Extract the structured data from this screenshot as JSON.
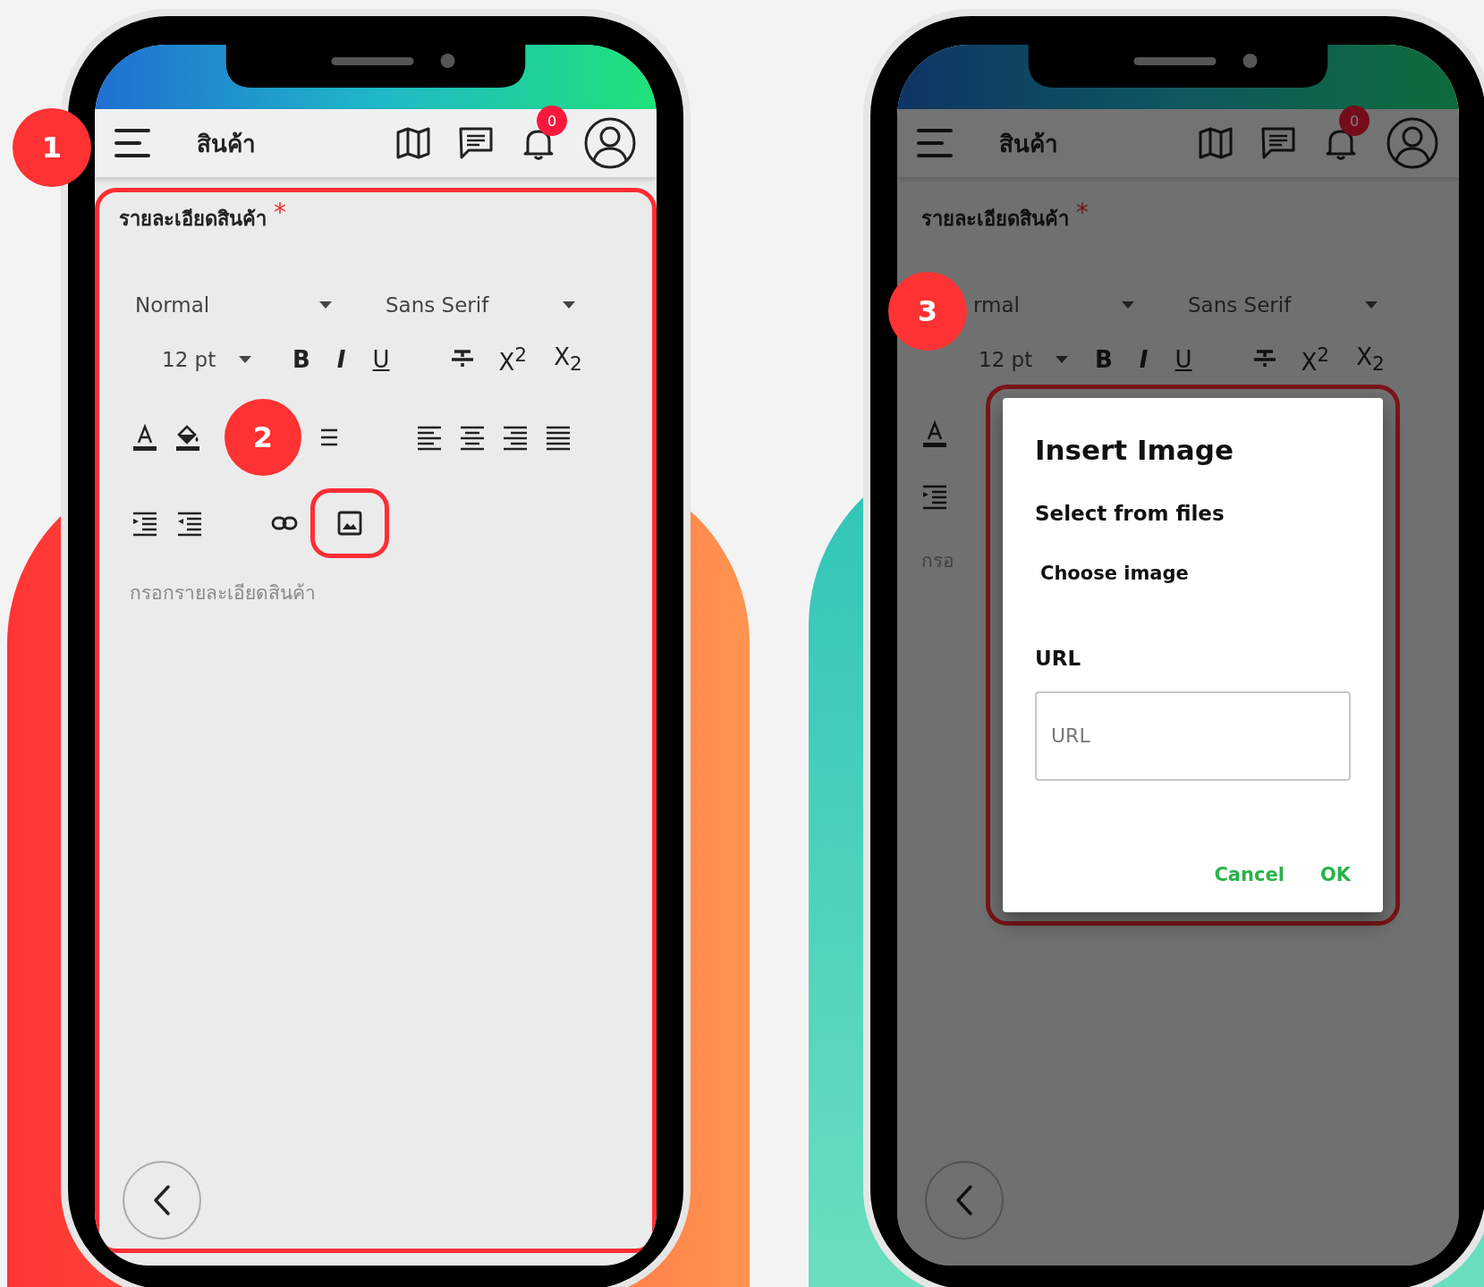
{
  "phones": [
    {
      "kind": "editor",
      "dimmed": false,
      "app_bar": {
        "title": "สินค้า",
        "notification_count": "0"
      },
      "editor": {
        "highlighted": true,
        "field_label": "รายละเอียดสินค้า",
        "required_mark": "*",
        "style_select": "Normal",
        "font_select": "Sans Serif",
        "size_select": "12 pt",
        "format_buttons": [
          {
            "kind": "bold",
            "label": "B"
          },
          {
            "kind": "italic",
            "label": "I"
          },
          {
            "kind": "underline",
            "label": "U"
          },
          {
            "kind": "strike"
          },
          {
            "kind": "superscript",
            "label": "X$^{2}$"
          },
          {
            "kind": "subscript",
            "label": "X$_{2}$"
          }
        ],
        "placeholder": "กรอกรายละเอียดสินค้า",
        "image_tool_highlighted": true
      },
      "step_badges": [
        "1",
        "2"
      ]
    },
    {
      "kind": "dialog",
      "dimmed": true,
      "app_bar": {
        "title": "สินค้า",
        "notification_count": "0"
      },
      "editor": {
        "highlighted": false,
        "field_label": "รายละเอียดสินค้า",
        "required_mark": "*",
        "style_select": "rmal",
        "font_select": "Sans Serif",
        "size_select": "12 pt",
        "format_buttons": [
          {
            "kind": "bold",
            "label": "B"
          },
          {
            "kind": "italic",
            "label": "I"
          },
          {
            "kind": "underline",
            "label": "U"
          },
          {
            "kind": "strike"
          },
          {
            "kind": "superscript",
            "label": "X$^{2}$"
          },
          {
            "kind": "subscript",
            "label": "X$_{2}$"
          }
        ],
        "placeholder": "กรอ"
      },
      "step_badges": [
        "3"
      ],
      "dialog": {
        "highlighted": true,
        "title": "Insert Image",
        "section": "Select from files",
        "choose_button": "Choose image",
        "url_label": "URL",
        "url_placeholder": "URL",
        "actions": [
          "Cancel",
          "OK"
        ]
      }
    }
  ]
}
